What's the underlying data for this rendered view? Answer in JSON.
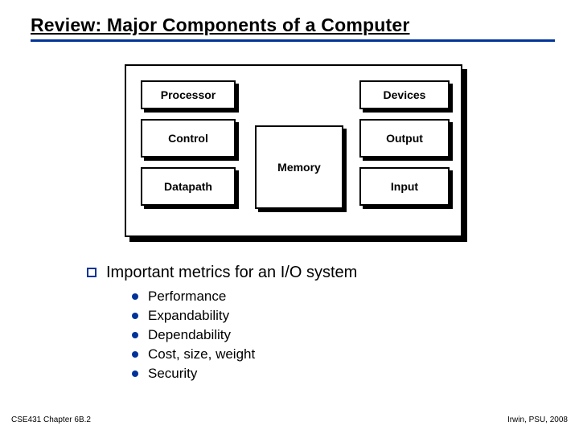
{
  "title": "Review:  Major Components of a Computer",
  "diagram": {
    "processor_header": "Processor",
    "control": "Control",
    "datapath": "Datapath",
    "memory": "Memory",
    "devices_header": "Devices",
    "output": "Output",
    "input": "Input"
  },
  "main_bullet": "Important metrics for an I/O system",
  "sub_bullets": {
    "b0": "Performance",
    "b1": "Expandability",
    "b2": "Dependability",
    "b3": "Cost, size, weight",
    "b4": "Security"
  },
  "footer": {
    "left": "CSE431 Chapter 6B.2",
    "right": "Irwin, PSU, 2008"
  }
}
